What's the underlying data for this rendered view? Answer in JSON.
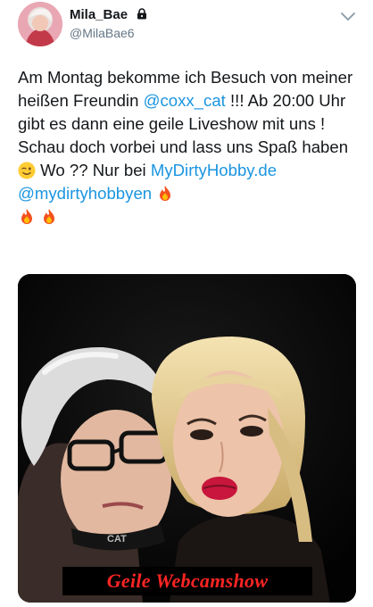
{
  "tweet": {
    "author": {
      "display_name": "Mila_Bae",
      "handle": "@MilaBae6",
      "protected_icon": "lock-icon"
    },
    "menu_icon": "chevron-down-icon",
    "text": {
      "seg1": "Am Montag bekomme ich Besuch von meiner heißen Freundin ",
      "mention1": "@coxx_cat",
      "seg2": " !!! Ab 20:00 Uhr gibt es dann eine geile Liveshow mit uns ! Schau doch vorbei und lass uns Spaß haben ",
      "seg3": " Wo ?? Nur bei ",
      "link1": "MyDirtyHobby.de",
      "seg4": " ",
      "mention2": "@mydirtyhobbyen",
      "seg5": " "
    },
    "emojis": [
      "winking-face-icon",
      "fire-icon",
      "fire-icon",
      "fire-icon"
    ],
    "media": {
      "caption": "Geile Webcamshow"
    }
  },
  "colors": {
    "link": "#1b95e0",
    "text": "#14171a",
    "secondary": "#657786",
    "caption": "#ff2424"
  }
}
